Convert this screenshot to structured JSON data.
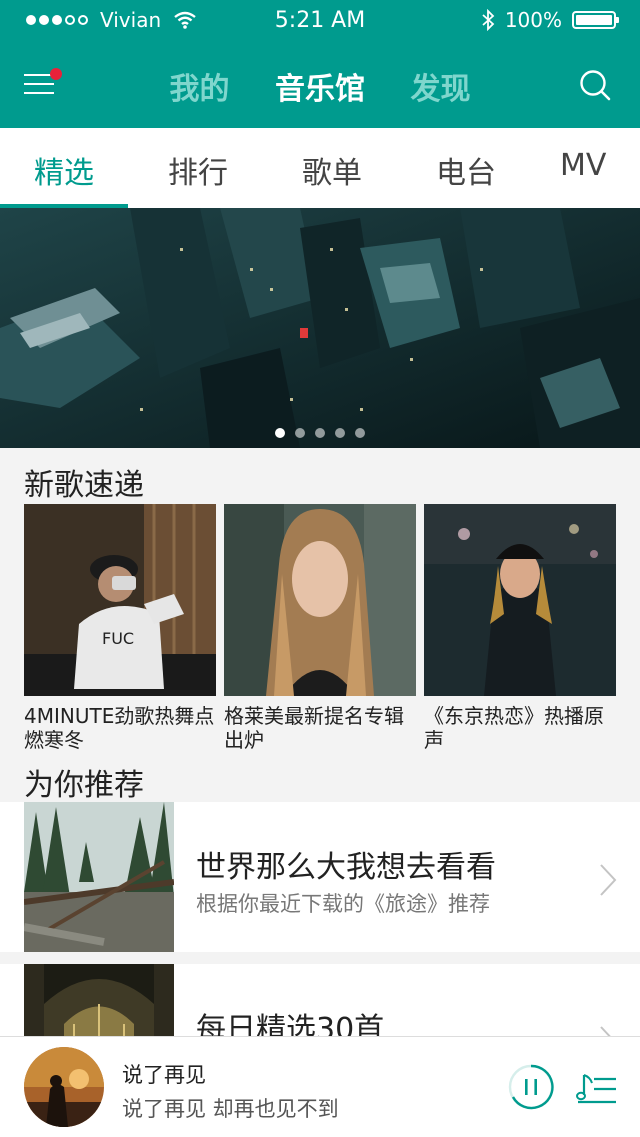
{
  "status": {
    "carrier": "Vivian",
    "time": "5:21 AM",
    "battery": "100%",
    "signal_strength_bars": 3,
    "signal_total": 5
  },
  "header": {
    "tabs": [
      "我的",
      "音乐馆",
      "发现"
    ],
    "active_tab": 1
  },
  "categories": [
    "精选",
    "排行",
    "歌单",
    "电台",
    "MV"
  ],
  "banner": {
    "page_count": 5,
    "active_page": 0
  },
  "new_songs": {
    "title": "新歌速递",
    "items": [
      {
        "caption": "4MINUTE劲歌热舞点燃寒冬"
      },
      {
        "caption": "格莱美最新提名专辑出炉"
      },
      {
        "caption": "《东京热恋》热播原声"
      }
    ]
  },
  "recommend": {
    "title": "为你推荐",
    "items": [
      {
        "title": "世界那么大我想去看看",
        "subtitle": "根据你最近下载的《旅途》推荐"
      },
      {
        "title": "每日精选30首",
        "subtitle": ""
      }
    ]
  },
  "player": {
    "song": "说了再见",
    "lyric": "说了再见 却再也见不到"
  },
  "colors": {
    "accent": "#009b8e",
    "notification": "#e8213a"
  }
}
